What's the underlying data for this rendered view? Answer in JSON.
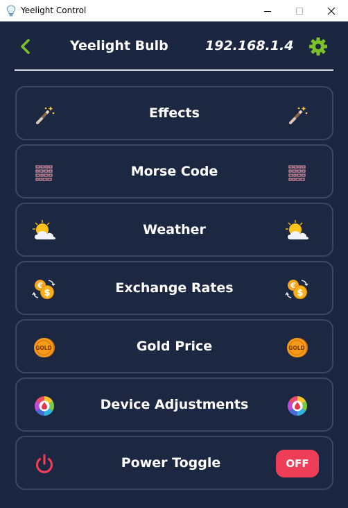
{
  "window": {
    "title": "Yeelight Control"
  },
  "header": {
    "title": "Yeelight Bulb",
    "ip": "192.168.1.4"
  },
  "cards": [
    {
      "label": "Effects",
      "icon": "magic-wand-icon"
    },
    {
      "label": "Morse Code",
      "icon": "morse-grid-icon"
    },
    {
      "label": "Weather",
      "icon": "sun-behind-cloud-icon"
    },
    {
      "label": "Exchange Rates",
      "icon": "currency-exchange-icon"
    },
    {
      "label": "Gold Price",
      "icon": "gold-coin-icon"
    },
    {
      "label": "Device Adjustments",
      "icon": "color-wheel-icon"
    },
    {
      "label": "Power Toggle",
      "icon": "power-icon"
    }
  ],
  "power": {
    "state_label": "OFF"
  },
  "gold_coin_text": "GOLD",
  "colors": {
    "background": "#1b2640",
    "card_border": "#3a4868",
    "accent_green": "#7cc02a",
    "power_red": "#ee3e57"
  }
}
